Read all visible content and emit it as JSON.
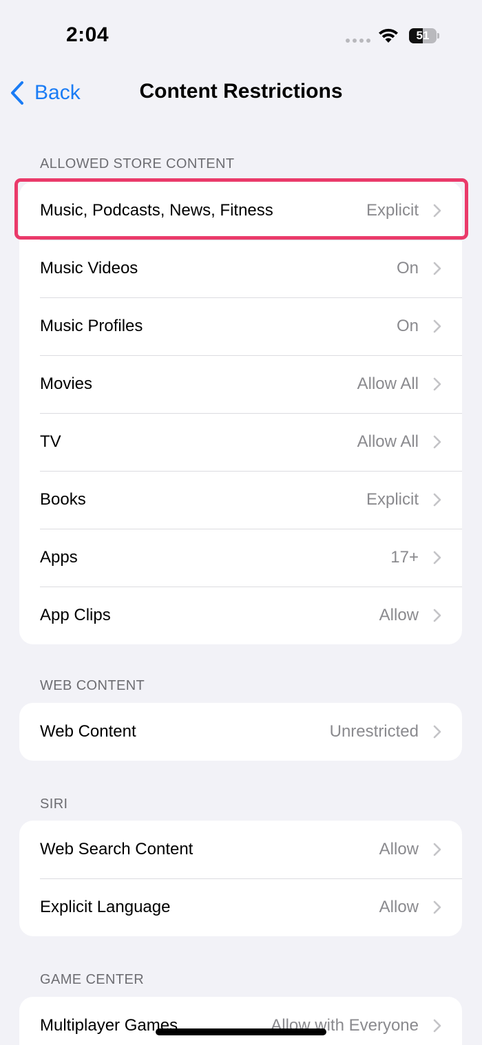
{
  "status_bar": {
    "time": "2:04",
    "battery_level": "51",
    "battery_fraction": 0.51
  },
  "nav": {
    "back_label": "Back",
    "title": "Content Restrictions"
  },
  "sections": {
    "store": {
      "header": "ALLOWED STORE CONTENT",
      "rows": [
        {
          "label": "Music, Podcasts, News, Fitness",
          "value": "Explicit"
        },
        {
          "label": "Music Videos",
          "value": "On"
        },
        {
          "label": "Music Profiles",
          "value": "On"
        },
        {
          "label": "Movies",
          "value": "Allow All"
        },
        {
          "label": "TV",
          "value": "Allow All"
        },
        {
          "label": "Books",
          "value": "Explicit"
        },
        {
          "label": "Apps",
          "value": "17+"
        },
        {
          "label": "App Clips",
          "value": "Allow"
        }
      ]
    },
    "web": {
      "header": "WEB CONTENT",
      "rows": [
        {
          "label": "Web Content",
          "value": "Unrestricted"
        }
      ]
    },
    "siri": {
      "header": "SIRI",
      "rows": [
        {
          "label": "Web Search Content",
          "value": "Allow"
        },
        {
          "label": "Explicit Language",
          "value": "Allow"
        }
      ]
    },
    "game_center": {
      "header": "GAME CENTER",
      "rows": [
        {
          "label": "Multiplayer Games",
          "value": "Allow with Everyone"
        }
      ]
    }
  },
  "colors": {
    "accent": "#1a7cf5",
    "highlight": "#ea3a6a",
    "background": "#f2f2f7"
  }
}
